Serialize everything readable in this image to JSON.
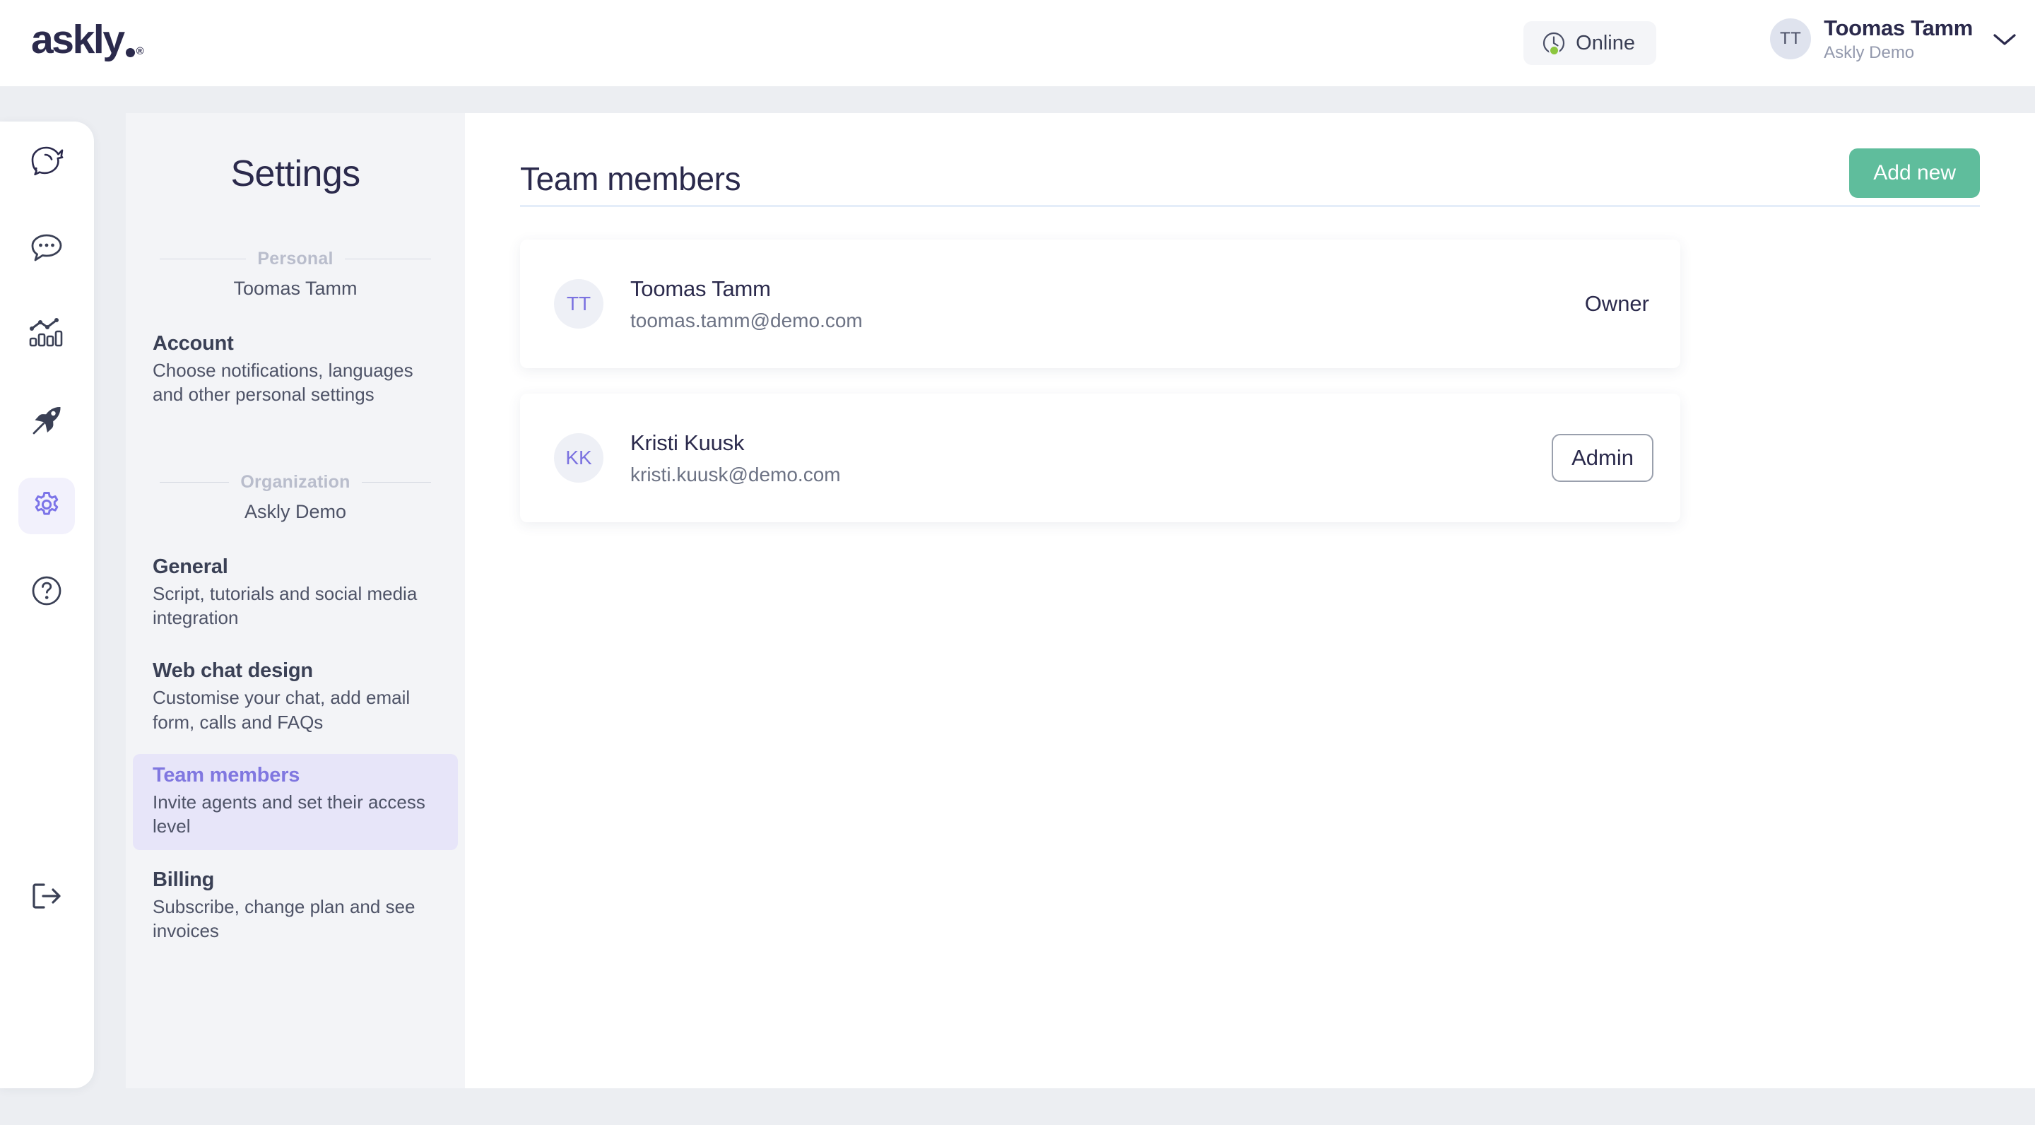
{
  "brand": {
    "name": "askly",
    "trademark": "®"
  },
  "header": {
    "status": {
      "label": "Online",
      "dot_color": "#8cc63e"
    },
    "user": {
      "initials": "TT",
      "name": "Toomas Tamm",
      "org": "Askly Demo"
    }
  },
  "rail": {
    "items": [
      {
        "icon": "askly-logo-mark-icon",
        "name": "home",
        "active": false
      },
      {
        "icon": "chat-bubble-icon",
        "name": "chats",
        "active": false
      },
      {
        "icon": "analytics-chart-icon",
        "name": "analytics",
        "active": false
      },
      {
        "icon": "rocket-icon",
        "name": "campaigns",
        "active": false
      },
      {
        "icon": "gear-icon",
        "name": "settings",
        "active": true
      },
      {
        "icon": "help-circle-icon",
        "name": "help",
        "active": false
      }
    ],
    "logout": {
      "icon": "logout-icon",
      "name": "logout"
    }
  },
  "settings": {
    "title": "Settings",
    "sections": [
      {
        "label": "Personal",
        "subtitle": "Toomas Tamm",
        "items": [
          {
            "title": "Account",
            "desc": "Choose notifications, languages and other personal settings",
            "active": false
          }
        ]
      },
      {
        "label": "Organization",
        "subtitle": "Askly Demo",
        "items": [
          {
            "title": "General",
            "desc": "Script, tutorials and social media integration",
            "active": false
          },
          {
            "title": "Web chat design",
            "desc": "Customise your chat, add email form, calls and FAQs",
            "active": false
          },
          {
            "title": "Team members",
            "desc": "Invite agents and set their access level",
            "active": true
          },
          {
            "title": "Billing",
            "desc": "Subscribe, change plan and see invoices",
            "active": false
          }
        ]
      }
    ]
  },
  "main": {
    "title": "Team members",
    "add_button": "Add new",
    "members": [
      {
        "initials": "TT",
        "name": "Toomas Tamm",
        "email": "toomas.tamm@demo.com",
        "role": "Owner",
        "role_is_button": false
      },
      {
        "initials": "KK",
        "name": "Kristi Kuusk",
        "email": "kristi.kuusk@demo.com",
        "role": "Admin",
        "role_is_button": true
      }
    ]
  },
  "colors": {
    "brand_navy": "#2b2a4c",
    "accent_purple": "#7c74e8",
    "accent_green": "#5fbd9c",
    "status_green": "#8cc63e",
    "panel_gray": "#f3f4f7"
  }
}
